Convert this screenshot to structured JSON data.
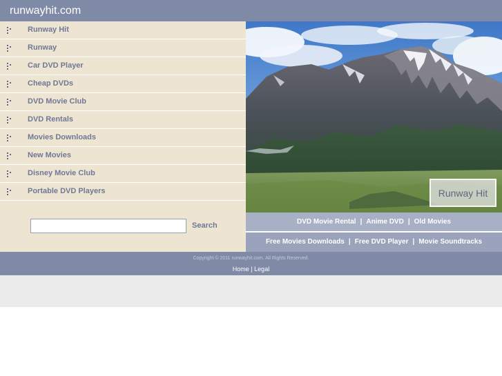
{
  "site": {
    "title": "runwayhit.com"
  },
  "nav": {
    "items": [
      {
        "label": "Runway Hit"
      },
      {
        "label": "Runway"
      },
      {
        "label": "Car DVD Player"
      },
      {
        "label": "Cheap DVDs"
      },
      {
        "label": "DVD Movie Club"
      },
      {
        "label": "DVD Rentals"
      },
      {
        "label": "Movies Downloads"
      },
      {
        "label": "New Movies"
      },
      {
        "label": "Disney Movie Club"
      },
      {
        "label": "Portable DVD Players"
      }
    ]
  },
  "search": {
    "value": "",
    "placeholder": "",
    "button_label": "Search"
  },
  "hero": {
    "badge_text": "Runway Hit"
  },
  "links": {
    "row1": [
      "DVD Movie Rental",
      "Anime DVD",
      "Old Movies"
    ],
    "row2": [
      "Free Movies Downloads",
      "Free DVD Player",
      "Movie Soundtracks"
    ],
    "separator": "|"
  },
  "footer": {
    "copyright": "Copyright © 2011 runwayhit.com. All Rights Reserved.",
    "home_label": "Home",
    "separator": "|",
    "legal_label": "Legal"
  },
  "colors": {
    "header": "#7f8aa6",
    "sidebar": "#ede4d2",
    "link_text": "#6f7895",
    "link_bar": "#9aa3bb"
  }
}
